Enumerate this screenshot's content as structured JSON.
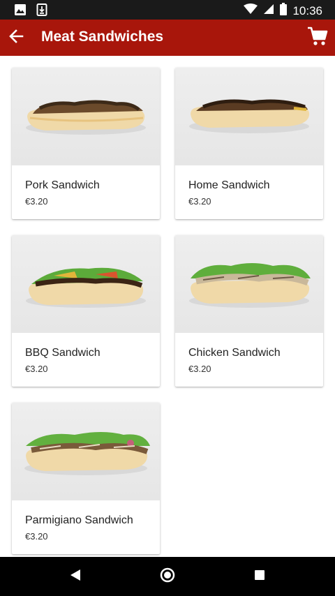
{
  "status_bar": {
    "time": "10:36",
    "icons": [
      "image-icon",
      "download-icon",
      "wifi-icon",
      "signal-icon",
      "battery-icon"
    ]
  },
  "app_bar": {
    "title": "Meat Sandwiches",
    "back_icon": "back-arrow-icon",
    "cart_icon": "cart-icon",
    "background": "#a8160b"
  },
  "products": [
    {
      "name": "Pork Sandwich",
      "price": "€3.20",
      "image": "pork-sandwich-image"
    },
    {
      "name": "Home Sandwich",
      "price": "€3.20",
      "image": "home-sandwich-image"
    },
    {
      "name": "BBQ Sandwich",
      "price": "€3.20",
      "image": "bbq-sandwich-image"
    },
    {
      "name": "Chicken Sandwich",
      "price": "€3.20",
      "image": "chicken-sandwich-image"
    },
    {
      "name": "Parmigiano Sandwich",
      "price": "€3.20",
      "image": "parmigiano-sandwich-image"
    }
  ],
  "nav_bar": {
    "icons": [
      "nav-back-icon",
      "nav-home-icon",
      "nav-recents-icon"
    ]
  }
}
